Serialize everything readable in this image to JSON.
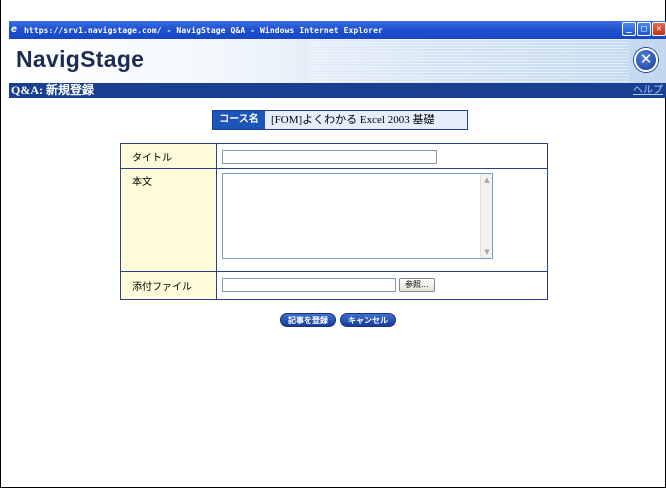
{
  "window": {
    "title": "https://srv1.navigstage.com/ - NavigStage Q&A - Windows Internet Explorer",
    "controls": {
      "minimize": "_",
      "maximize": "□",
      "close": "✕"
    }
  },
  "header": {
    "logo": "NavigStage",
    "close_symbol": "✕"
  },
  "pagebar": {
    "title": "Q&A: 新規登録",
    "help_link": "ヘルプ"
  },
  "course": {
    "label": "コース名",
    "value": "[FOM]よくわかる Excel 2003 基礎"
  },
  "form": {
    "title_label": "タイトル",
    "title_value": "",
    "body_label": "本文",
    "body_value": "",
    "attachment_label": "添付ファイル",
    "attachment_value": "",
    "browse_label": "参照..."
  },
  "actions": {
    "submit_label": "記事を登録",
    "cancel_label": "キャンセル"
  },
  "colors": {
    "titlebar": "#1d4fd0",
    "pagebar": "#1a3f91",
    "label_bg": "#fdfbd9",
    "button": "#1f4bb0"
  }
}
